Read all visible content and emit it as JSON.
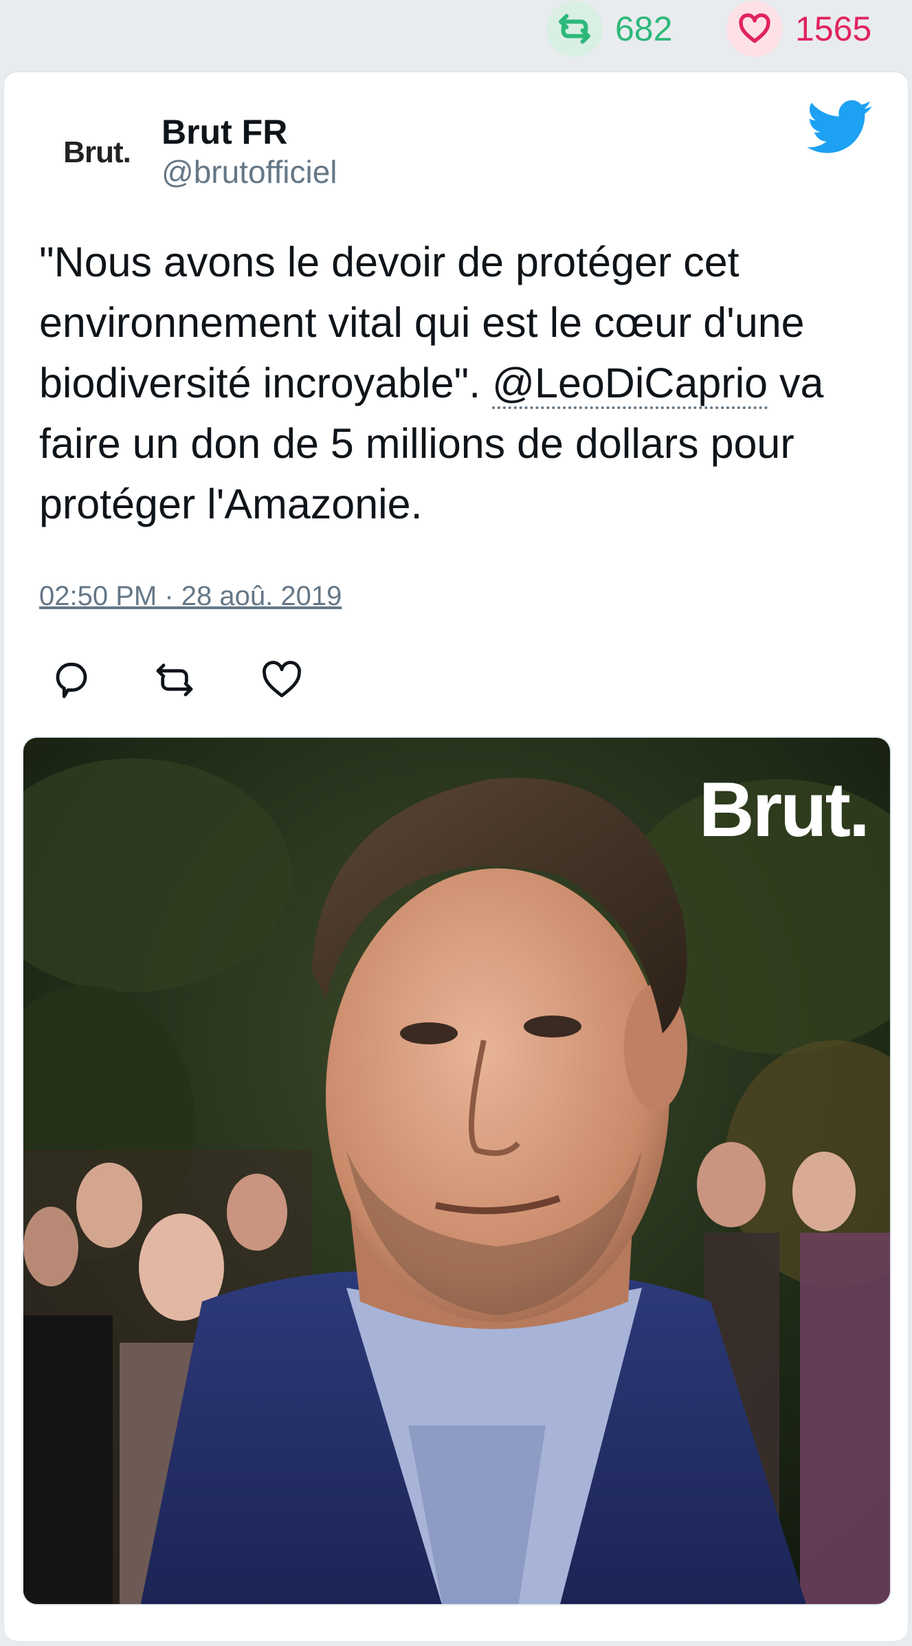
{
  "stats": {
    "retweets": "682",
    "likes": "1565",
    "retweet_color": "#2db87a",
    "like_color": "#e0245e"
  },
  "user": {
    "avatar_text": "Brut.",
    "name": "Brut FR",
    "handle": "@brutofficiel"
  },
  "tweet": {
    "text_before": "\"Nous avons le devoir de protéger cet environnement vital qui est le cœur d'une biodiversité incroyable\". ",
    "mention": "@LeoDiCaprio",
    "text_after": " va faire un don de 5 millions de dollars pour protéger l'Amazonie.",
    "timestamp": "02:50 PM · 28 aoû. 2019"
  },
  "media": {
    "watermark": "Brut."
  },
  "icons": {
    "twitter_bird": "twitter-bird-icon",
    "reply": "reply-icon",
    "retweet": "retweet-icon",
    "like": "heart-icon",
    "twitter_blue": "#1da1f2"
  }
}
